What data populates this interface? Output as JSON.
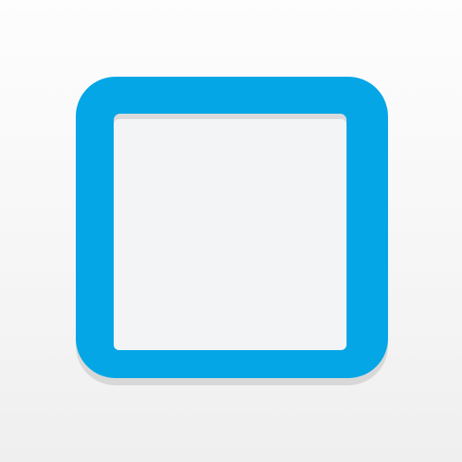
{
  "app_icon": {
    "glyph": "square-outline-icon",
    "colors": {
      "background_top": "#fdfdfd",
      "background_bottom": "#efefef",
      "frame": "#04a6e6",
      "frame_shadow": "#d8d8d8",
      "inner_fill": "#f3f4f6",
      "inner_shadow": "#d9dadc"
    }
  }
}
